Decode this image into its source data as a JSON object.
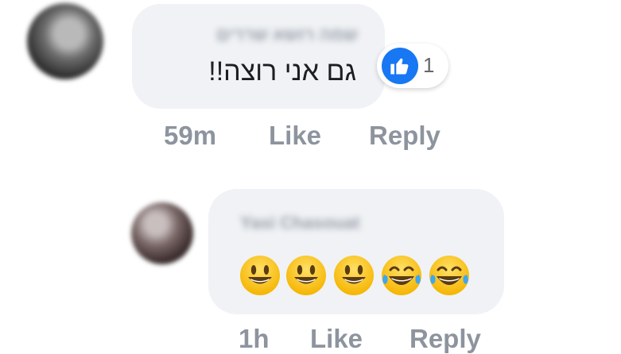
{
  "comments": [
    {
      "author": "שמה רושא שררים",
      "text": "גם אני רוצה!!",
      "reactions": {
        "icon": "like-thumb-icon",
        "count": "1"
      },
      "time": "59m",
      "like_label": "Like",
      "reply_label": "Reply"
    },
    {
      "author": "Yasi Chasouat",
      "emojis": [
        "grinning-face-icon",
        "grinning-face-icon",
        "grinning-face-icon",
        "tears-of-joy-icon",
        "tears-of-joy-icon"
      ],
      "time": "1h",
      "like_label": "Like",
      "reply_label": "Reply"
    }
  ],
  "colors": {
    "bubble": "#f0f2f5",
    "like_blue": "#1877f2",
    "meta_gray": "#8d949e",
    "text": "#1c1e21"
  }
}
